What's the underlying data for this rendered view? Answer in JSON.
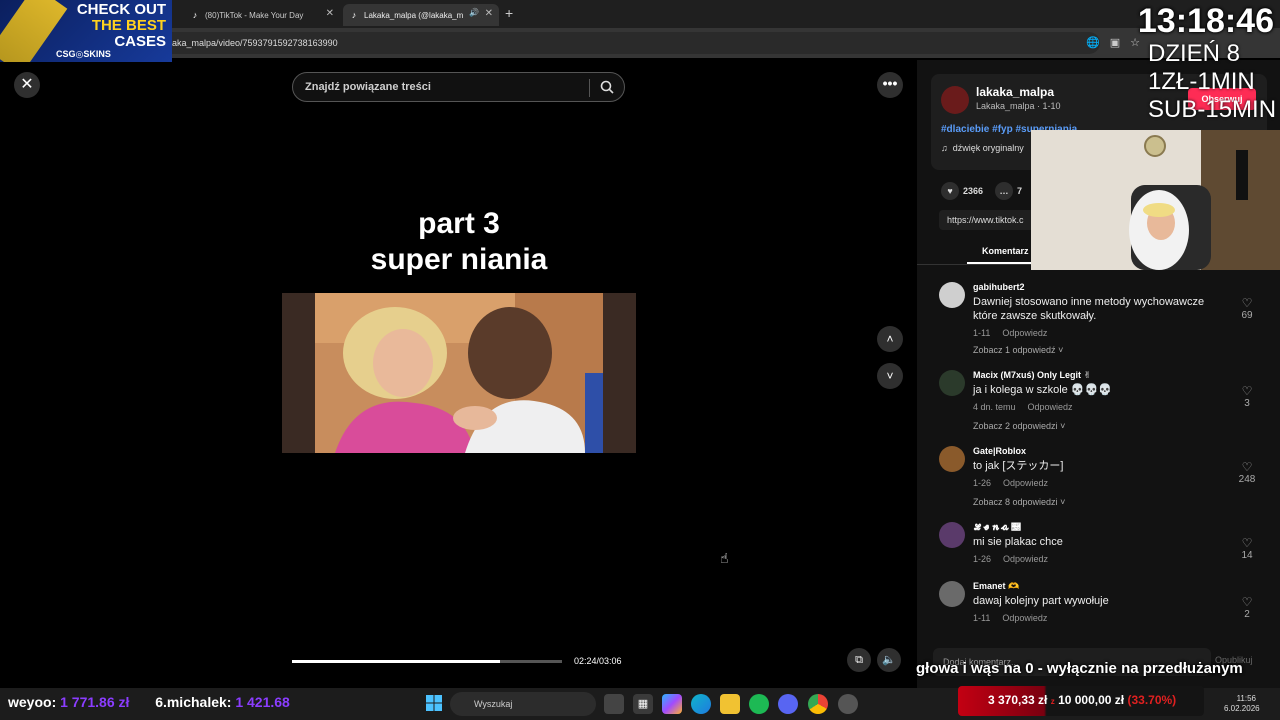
{
  "browser": {
    "tabs": [
      {
        "label": "(80)TikTok - Make Your Day"
      },
      {
        "label": "Lakaka_malpa (@lakaka_m"
      }
    ],
    "url": "aka_malpa/video/7593791592738163990"
  },
  "ad": {
    "line1": "CHECK OUT",
    "line2": "THE BEST",
    "line3": "CASES",
    "brand": "CSG◎SKINS"
  },
  "stream_overlay": {
    "clock": "13:18:46",
    "info_lines": [
      "DZIEŃ 8",
      "1ZŁ-1MIN",
      "SUB-15MIN"
    ],
    "ticker": "głowa i wąs na 0 - wyłącznie na przedłużanym",
    "donors": [
      {
        "name": "weyoo:",
        "amount": "1 771.86 zł"
      },
      {
        "name": "6.michalek:",
        "amount": "1 421.68"
      }
    ],
    "goal": {
      "current": "3 370,33 zł",
      "separator": "z",
      "target": "10 000,00 zł",
      "percent": "(33.70%)"
    }
  },
  "video": {
    "search_placeholder": "Znajdź powiązane treści",
    "title_line1": "part 3",
    "title_line2": "super niania",
    "progress": 0.77,
    "timecode": "02:24/03:06"
  },
  "author": {
    "name": "lakaka_malpa",
    "sub": "Lakaka_malpa · 1-10",
    "follow_label": "Obserwuj",
    "hashtags": "#dlaciebie #fyp #superniania",
    "sound": "dźwięk oryginalny",
    "likes": "2366",
    "comments": "7",
    "link": "https://www.tiktok.c"
  },
  "comments_tab": "Komentarz",
  "comments": [
    {
      "user": "gabihubert2",
      "text": "Dawniej stosowano inne metody wychowawcze które zawsze skutkowały.",
      "date": "1-11",
      "reply": "Odpowiedz",
      "replies": "Zobacz 1 odpowiedź",
      "likes": "69",
      "color": "#cfcfcf"
    },
    {
      "user": "Macix (M7xuś) Only Legit ✌",
      "text": "ja i kolega w szkole 💀💀💀",
      "date": "4 dn. temu",
      "reply": "Odpowiedz",
      "replies": "Zobacz 2 odpowiedzi",
      "likes": "3",
      "color": "#2b3a2b"
    },
    {
      "user": "Gate|Roblox",
      "text": "to jak [ステッカー]",
      "date": "1-26",
      "reply": "Odpowiedz",
      "replies": "Zobacz 8 odpowiedzi",
      "likes": "248",
      "color": "#8a5a2b"
    },
    {
      "user": "𝓛𝓮𝓷𝓪 🩽",
      "text": "mi sie plakac chce",
      "date": "1-26",
      "reply": "Odpowiedz",
      "replies": "",
      "likes": "14",
      "color": "#5a3a6a"
    },
    {
      "user": "Emanet 🫶",
      "text": "dawaj kolejny part wywołuje",
      "date": "1-11",
      "reply": "Odpowiedz",
      "replies": "",
      "likes": "2",
      "color": "#6a6a6a"
    }
  ],
  "add_comment_placeholder": "Dodaj komentarz...",
  "publish_label": "Opublikuj",
  "taskbar": {
    "search_label": "Wyszukaj",
    "time": "11:56",
    "date": "6.02.2026"
  }
}
